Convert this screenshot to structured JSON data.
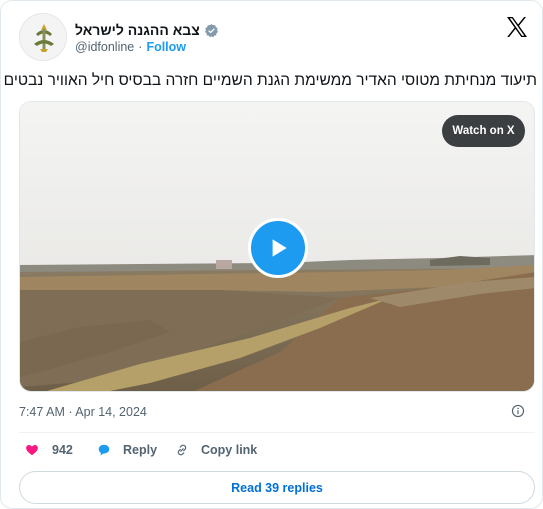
{
  "author": {
    "name": "צבא ההגנה לישראל",
    "handle": "@idfonline",
    "separator": "·",
    "follow_label": "Follow"
  },
  "tweet": {
    "text": "תיעוד מנחיתת מטוסי האדיר ממשימת הגנת השמיים חזרה בבסיס חיל האוויר נבטים",
    "timestamp": "7:47 AM · Apr 14, 2024"
  },
  "media": {
    "watch_label": "Watch on X",
    "play_icon": "play-icon"
  },
  "actions": {
    "likes_count": "942",
    "reply_label": "Reply",
    "copy_link_label": "Copy link"
  },
  "footer": {
    "read_replies_label": "Read 39 replies"
  },
  "colors": {
    "accent": "#1d9bf0",
    "like": "#f91880",
    "text": "#0f1419",
    "muted": "#536471"
  }
}
